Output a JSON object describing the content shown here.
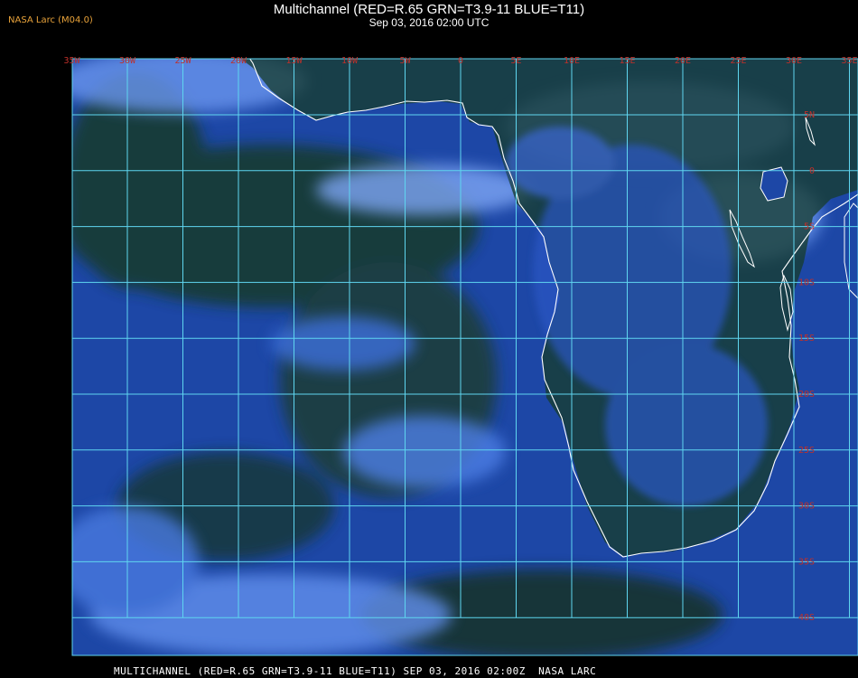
{
  "header": {
    "badge": "NASA Larc (M04.0)",
    "title": "Multichannel (RED=R.65 GRN=T3.9-11 BLUE=T11)",
    "datetime": "Sep 03, 2016 02:00 UTC"
  },
  "footer": {
    "text": "MULTICHANNEL (RED=R.65 GRN=T3.9-11 BLUE=T11) SEP 03, 2016 02:00Z  NASA LARC"
  },
  "map": {
    "longitude_labels": [
      "35W",
      "30W",
      "25W",
      "20W",
      "15W",
      "10W",
      "5W",
      "0",
      "5E",
      "10E",
      "15E",
      "20E",
      "25E",
      "30E",
      "35E"
    ],
    "latitude_labels": [
      "5N",
      "0",
      "5S",
      "10S",
      "15S",
      "20S",
      "25S",
      "30S",
      "35S",
      "40S"
    ],
    "colors": {
      "grid": "#5fd6f0",
      "label": "#c0302a",
      "coast": "#ffffff",
      "ocean": "#1f4fb0",
      "cloud": "#8fb8ff",
      "land": "#123a20"
    }
  }
}
